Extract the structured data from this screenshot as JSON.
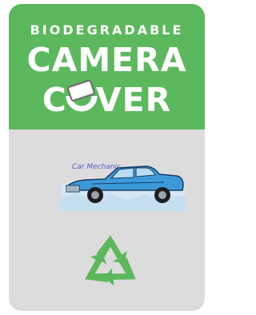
{
  "label": {
    "kicker": "BIODEGRADABLE",
    "line1": "CAMERA",
    "line2_start": "C",
    "line2_end": "VER"
  },
  "illustration": {
    "caption": "Car Mechanic",
    "car_color": "#3d9ad8"
  },
  "colors": {
    "header_green": "#5cb85c",
    "body_gray": "#dcdcdc",
    "recycle_green": "#5cb85c"
  },
  "icons": {
    "camera_cover": "camera-cover-icon",
    "recycle": "recycle-icon"
  }
}
